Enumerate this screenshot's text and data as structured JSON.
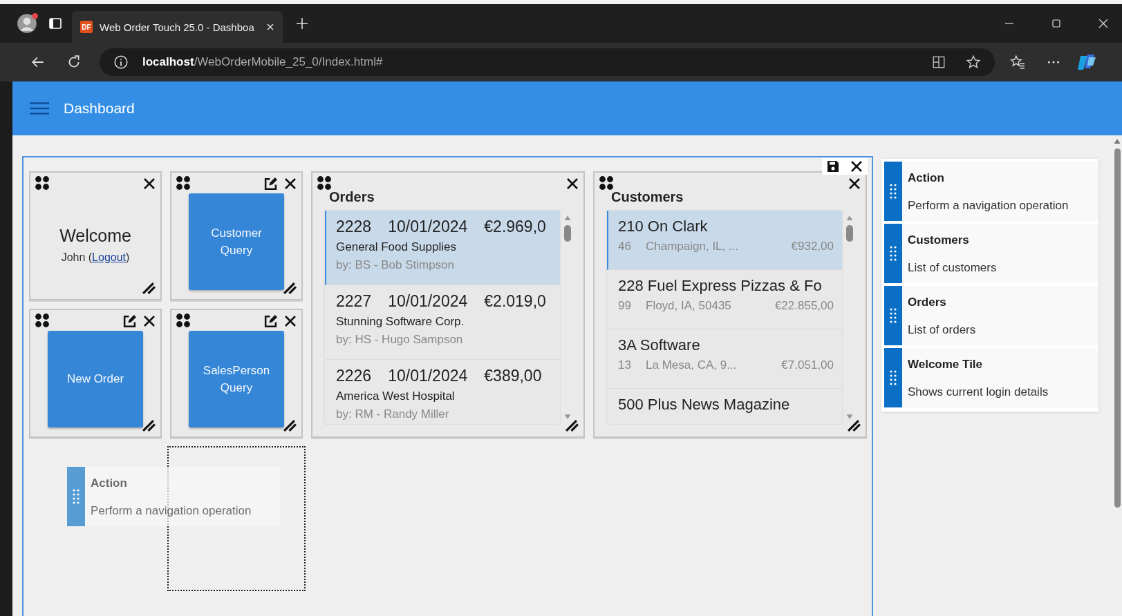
{
  "browser": {
    "tab_favicon": "DF",
    "tab_title": "Web Order Touch 25.0 - Dashboa",
    "url_host": "localhost",
    "url_path": "/WebOrderMobile_25_0/Index.html#"
  },
  "header": {
    "title": "Dashboard"
  },
  "tiles": [
    {
      "kind": "welcome",
      "heading": "Welcome",
      "user": "John (",
      "link": "Logout",
      "after_link": ")",
      "editable": false
    },
    {
      "kind": "button",
      "label": "Customer Query",
      "editable": true
    },
    {
      "kind": "orders",
      "title": "Orders",
      "editable": false,
      "rows": [
        {
          "number": "2228",
          "date": "10/01/2024",
          "amount": "€2.969,0",
          "customer": "General Food Supplies",
          "salesperson": "by: BS - Bob Stimpson",
          "selected": true
        },
        {
          "number": "2227",
          "date": "10/01/2024",
          "amount": "€2.019,0",
          "customer": "Stunning Software Corp.",
          "salesperson": "by: HS - Hugo Sampson",
          "selected": false
        },
        {
          "number": "2226",
          "date": "10/01/2024",
          "amount": "€389,00",
          "customer": "America West Hospital",
          "salesperson": "by: RM - Randy Miller",
          "selected": false
        }
      ]
    },
    {
      "kind": "customers",
      "title": "Customers",
      "editable": false,
      "rows": [
        {
          "name": "210 On Clark",
          "count": "46",
          "city": "Champaign, IL, ...",
          "amount": "€932,00",
          "selected": true
        },
        {
          "name": "228 Fuel Express Pizzas & Fo",
          "count": "99",
          "city": "Floyd, IA, 50435",
          "amount": "€22.855,00",
          "selected": false
        },
        {
          "name": "3A Software",
          "count": "13",
          "city": "La Mesa, CA, 9...",
          "amount": "€7.051,00",
          "selected": false
        },
        {
          "name": "500 Plus News Magazine",
          "selected": false
        }
      ]
    },
    {
      "kind": "button",
      "label": "New Order",
      "editable": true
    },
    {
      "kind": "button",
      "label": "SalesPerson Query",
      "editable": true
    }
  ],
  "dragging": {
    "title": "Action",
    "description": "Perform a navigation operation"
  },
  "palette": [
    {
      "title": "Action",
      "description": "Perform a navigation operation"
    },
    {
      "title": "Customers",
      "description": "List of customers"
    },
    {
      "title": "Orders",
      "description": "List of orders"
    },
    {
      "title": "Welcome Tile",
      "description": "Shows current login details"
    }
  ]
}
